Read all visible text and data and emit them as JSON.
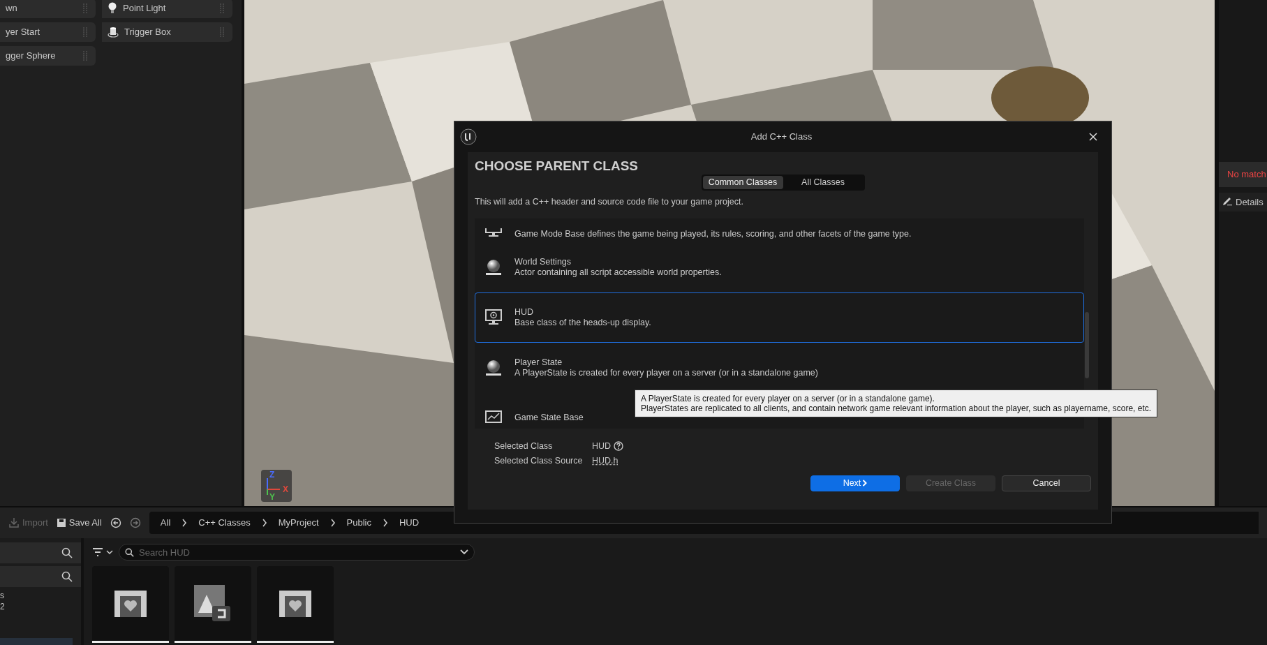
{
  "placement_panel": {
    "items": [
      {
        "label": "wn",
        "kind": "none"
      },
      {
        "label": "Point Light",
        "kind": "light"
      },
      {
        "label": "yer Start",
        "kind": "none"
      },
      {
        "label": "Trigger Box",
        "kind": "box"
      },
      {
        "label": "gger Sphere",
        "kind": "none"
      }
    ]
  },
  "viewport": {
    "gizmo_axes": [
      {
        "label": "Z",
        "color": "#4a6cff"
      },
      {
        "label": "X",
        "color": "#e0483c"
      },
      {
        "label": "Y",
        "color": "#4ec24e"
      }
    ]
  },
  "details_panel": {
    "message": "No match",
    "tab": "Details"
  },
  "content_browser": {
    "toolbar": [
      {
        "label": "Import",
        "disabled": true,
        "kind": "import"
      },
      {
        "label": "Save All",
        "disabled": false,
        "kind": "save"
      }
    ],
    "breadcrumbs": [
      "All",
      "C++ Classes",
      "MyProject",
      "Public",
      "HUD"
    ],
    "sidebar_texts": [
      "s",
      "2"
    ],
    "search": {
      "placeholder": "Search HUD"
    },
    "tiles": [
      {
        "kind": "widget"
      },
      {
        "kind": "texture"
      },
      {
        "kind": "widget"
      }
    ]
  },
  "dialog": {
    "title": "Add C++ Class",
    "heading": "CHOOSE PARENT CLASS",
    "tabs": [
      {
        "label": "Common Classes",
        "selected": true
      },
      {
        "label": "All Classes",
        "selected": false
      }
    ],
    "description": "This will add a C++ header and source code file to your game project.",
    "classes": [
      {
        "kind": "monitor",
        "description": "Game Mode Base defines the game being played, its rules, scoring, and other facets of the game type.",
        "selected": false
      },
      {
        "kind": "sphere",
        "name": "World Settings",
        "description": "Actor containing all script accessible world properties.",
        "selected": false
      },
      {
        "kind": "target",
        "name": "HUD",
        "description": "Base class of the heads-up display.",
        "selected": true
      },
      {
        "kind": "sphere",
        "name": "Player State",
        "description": "A PlayerState is created for every player on a server (or in a standalone game)",
        "selected": false
      },
      {
        "kind": "chart",
        "name": "Game State Base",
        "selected": false
      }
    ],
    "selected_class_label": "Selected Class",
    "selected_class": "HUD",
    "source_label": "Selected Class Source",
    "source": "HUD.h",
    "buttons": [
      {
        "label": "Next",
        "kind": "primary",
        "disabled": false
      },
      {
        "label": "Create Class",
        "kind": "normal",
        "disabled": true
      },
      {
        "label": "Cancel",
        "kind": "normal",
        "disabled": false
      }
    ]
  },
  "tooltip": {
    "lines": [
      "A PlayerState is created for every player on a server (or in a standalone game).",
      "PlayerStates are replicated to all clients, and contain network game relevant information about the player, such as playername, score, etc."
    ]
  }
}
